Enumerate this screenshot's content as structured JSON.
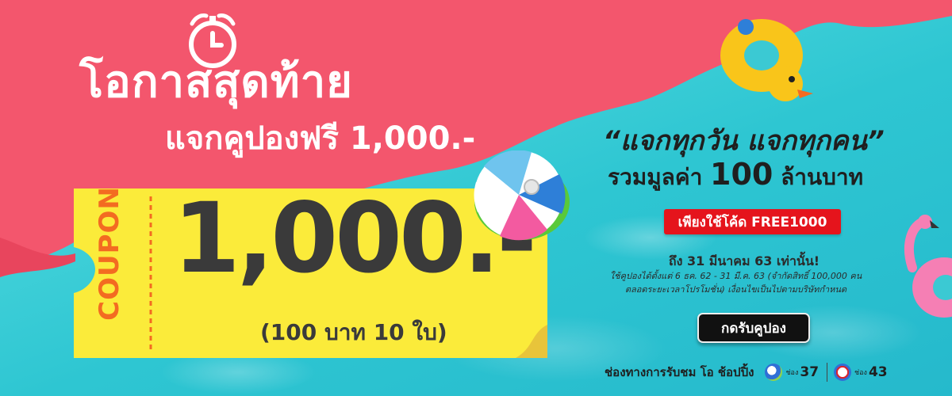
{
  "headline": "โอกาสสุดท้าย",
  "subheadline": "แจกคูปองฟรี 1,000.-",
  "coupon": {
    "label": "COUPON",
    "amount": "1,000.-",
    "detail": "(100 บาท 10 ใบ)"
  },
  "promo": {
    "quote": "“แจกทุกวัน แจกทุกคน”",
    "total_prefix": "รวมมูลค่า",
    "total_value": "100",
    "total_suffix": "ล้านบาท",
    "code_badge": "เพียงใช้โค้ด FREE1000",
    "deadline": "ถึง 31 มีนาคม 63 เท่านั้น!",
    "terms_line1": "ใช้คูปองได้ตั้งแต่ 6 ธค. 62 - 31 มี.ค. 63 (จำกัดสิทธิ์ 100,000 คน",
    "terms_line2": "ตลอดระยะเวลาโปรโมชั่น) เงื่อนไขเป็นไปตามบริษัทกำหนด",
    "cta_label": "กดรับคูปอง"
  },
  "channels": {
    "label": "ช่องทางการรับชม โอ ช้อปปิ้ง",
    "items": [
      {
        "prefix": "ช่อง",
        "number": "37",
        "logo_color": "#2f6fd6",
        "icon": "z-channel-logo-icon"
      },
      {
        "prefix": "ช่อง",
        "number": "43",
        "logo_color": "#d9232d",
        "icon": "psi-channel-logo-icon"
      }
    ]
  },
  "colors": {
    "pink": "#f3566d",
    "coupon_yellow": "#fbeb3a",
    "coupon_orange": "#f36b21",
    "code_red": "#e5141c",
    "water": "#38cfd6"
  }
}
